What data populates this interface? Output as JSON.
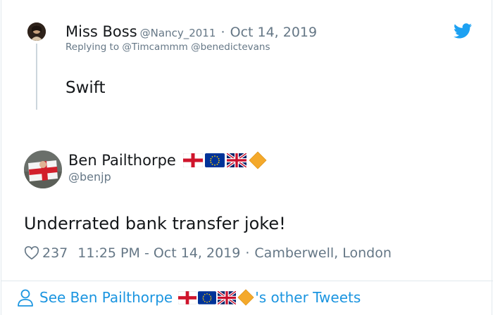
{
  "replied_tweet": {
    "name": "Miss Boss",
    "handle": "@Nancy_2011",
    "separator": "·",
    "date": "Oct 14, 2019",
    "replying_to": "Replying to @Timcammm @benedictevans",
    "text": "Swift"
  },
  "main_tweet": {
    "name": "Ben Pailthorpe",
    "handle": "@benjp",
    "text": "Underrated bank transfer joke!",
    "likes": "237",
    "datetime": "11:25 PM - Oct 14, 2019",
    "separator": "·",
    "location": "Camberwell, London",
    "name_emojis": [
      "england-flag",
      "eu-flag",
      "uk-flag",
      "orange-diamond"
    ]
  },
  "footer": {
    "prefix": "See Ben Pailthorpe",
    "suffix": "'s other Tweets"
  },
  "colors": {
    "link_blue": "#1b95e0",
    "text_dark": "#14171a",
    "text_gray": "#657786",
    "twitter_blue": "#1da1f2",
    "diamond_orange": "#f4a92b"
  }
}
